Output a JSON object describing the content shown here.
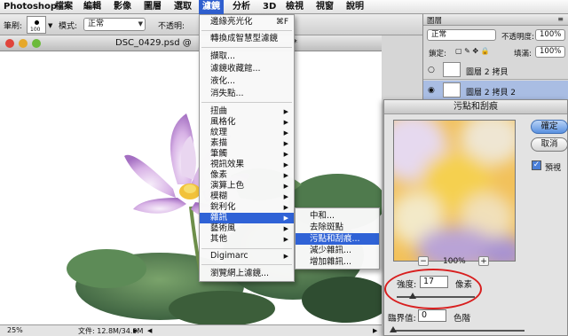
{
  "menubar": {
    "app": "Photoshop",
    "items": [
      "檔案",
      "編輯",
      "影像",
      "圖層",
      "選取",
      "濾鏡",
      "分析",
      "3D",
      "檢視",
      "視窗",
      "說明"
    ],
    "active_index": 5
  },
  "options": {
    "brush_label": "筆刷:",
    "brush_size": "100",
    "mode_label": "模式:",
    "mode_value": "正常",
    "opacity_label": "不透明:"
  },
  "document": {
    "title": "DSC_0429.psd @",
    "title_tail": "*",
    "zoom": "25%",
    "file_info": "文件: 12.8M/34.0M"
  },
  "filter_menu": {
    "items": [
      {
        "label": "邊緣亮光化",
        "shortcut": "⌘F"
      },
      {
        "label": "轉換成智慧型濾鏡"
      },
      {
        "label": "擷取..."
      },
      {
        "label": "濾鏡收藏館..."
      },
      {
        "label": "液化..."
      },
      {
        "label": "消失點..."
      },
      {
        "label": "扭曲",
        "sub": true
      },
      {
        "label": "風格化",
        "sub": true
      },
      {
        "label": "紋理",
        "sub": true
      },
      {
        "label": "素描",
        "sub": true
      },
      {
        "label": "筆觸",
        "sub": true
      },
      {
        "label": "視訊效果",
        "sub": true
      },
      {
        "label": "像素",
        "sub": true
      },
      {
        "label": "演算上色",
        "sub": true
      },
      {
        "label": "模糊",
        "sub": true
      },
      {
        "label": "銳利化",
        "sub": true
      },
      {
        "label": "雜訊",
        "sub": true
      },
      {
        "label": "藝術風",
        "sub": true
      },
      {
        "label": "其他",
        "sub": true
      },
      {
        "label": "Digimarc",
        "sub": true
      },
      {
        "label": "瀏覽網上濾鏡..."
      }
    ]
  },
  "noise_submenu": {
    "items": [
      "中和...",
      "去除斑點",
      "污點和刮痕...",
      "減少雜訊...",
      "增加雜訊..."
    ],
    "selected_index": 2
  },
  "layers_panel": {
    "tab": "圖層",
    "blend_mode": "正常",
    "opacity_label": "不透明度:",
    "opacity_value": "100%",
    "lock_label": "鎖定:",
    "fill_label": "填滿:",
    "fill_value": "100%",
    "layers": [
      {
        "name": "圖層 2 拷貝",
        "selected": false
      },
      {
        "name": "圖層 2 拷貝 2",
        "selected": true
      }
    ]
  },
  "dialog": {
    "title": "污點和刮痕",
    "ok_label": "確定",
    "cancel_label": "取消",
    "preview_label": "預視",
    "zoom_minus": "−",
    "zoom_plus": "+",
    "zoom_value": "100%",
    "radius_label": "強度:",
    "radius_value": "17",
    "radius_unit": "像素",
    "threshold_label": "臨界值:",
    "threshold_value": "0",
    "threshold_unit": "色階"
  },
  "colors": {
    "menu_highlight": "#2f62d6",
    "annotation_ellipse": "#d81f1f",
    "selected_layer": "#a9bde3"
  }
}
